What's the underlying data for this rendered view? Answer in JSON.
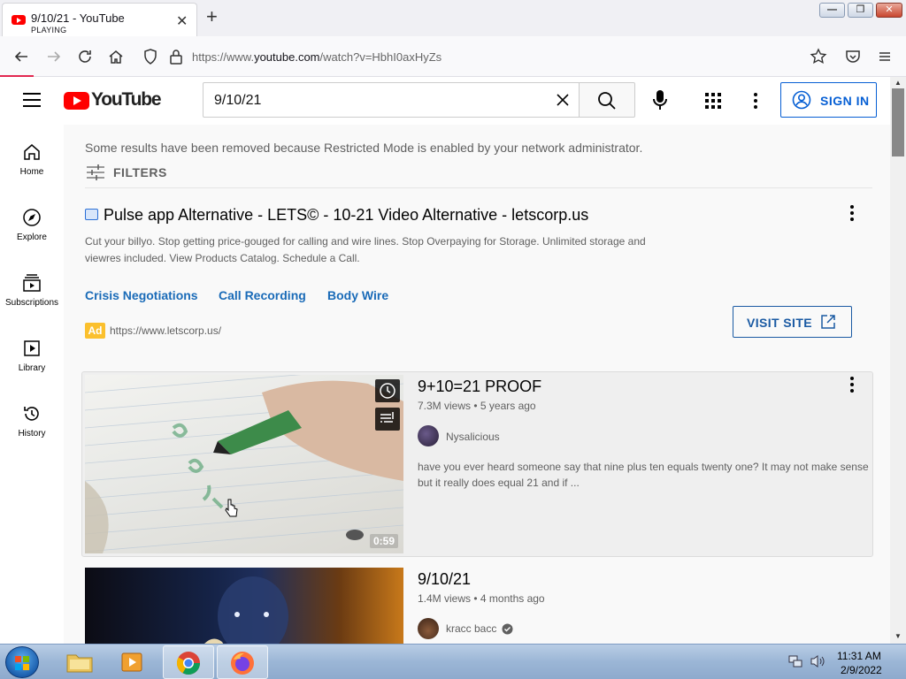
{
  "browser": {
    "tab_title": "9/10/21 - YouTube",
    "tab_status": "PLAYING",
    "url_prefix": "https://www.",
    "url_domain": "youtube.com",
    "url_path": "/watch?v=HbhI0axHyZs"
  },
  "header": {
    "logo_text": "YouTube",
    "search_value": "9/10/21",
    "sign_in_label": "SIGN IN"
  },
  "sidebar": {
    "items": [
      {
        "label": "Home",
        "icon": "home-icon"
      },
      {
        "label": "Explore",
        "icon": "compass-icon"
      },
      {
        "label": "Subscriptions",
        "icon": "subscriptions-icon"
      },
      {
        "label": "Library",
        "icon": "library-icon"
      },
      {
        "label": "History",
        "icon": "history-icon"
      }
    ]
  },
  "results": {
    "restricted_notice": "Some results have been removed because Restricted Mode is enabled by your network administrator.",
    "filters_label": "FILTERS"
  },
  "ad": {
    "title": "Pulse app Alternative - LETS© - 10-21 Video Alternative - letscorp.us",
    "description": "Cut your billyo. Stop getting price-gouged for calling and wire lines. Stop Overpaying for Storage. Unlimited storage and viewres included. View Products Catalog. Schedule a Call.",
    "sitelinks": [
      "Crisis Negotiations",
      "Call Recording",
      "Body Wire"
    ],
    "badge": "Ad",
    "url": "https://www.letscorp.us/",
    "visit_label": "VISIT SITE"
  },
  "videos": [
    {
      "title": "9+10=21 PROOF",
      "meta": "7.3M views • 5 years ago",
      "channel": "Nysalicious",
      "description": "have you ever heard someone say that nine plus ten equals twenty one? It may not make sense but it really does equal 21 and if ...",
      "duration": "0:59"
    },
    {
      "title": "9/10/21",
      "meta": "1.4M views • 4 months ago",
      "channel": "kracc bacc"
    }
  ],
  "taskbar": {
    "time": "11:31 AM",
    "date": "2/9/2022"
  },
  "colors": {
    "yt_red": "#ff0000",
    "link_blue": "#065fd4",
    "ad_yellow": "#fbc02d"
  }
}
